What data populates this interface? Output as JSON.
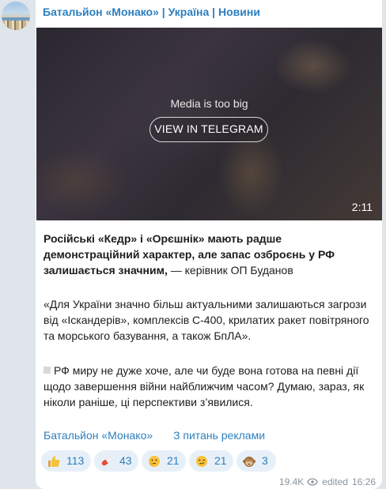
{
  "channel": {
    "title": "Батальйон «Монако» | Україна | Новини"
  },
  "media": {
    "message": "Media is too big",
    "button_label": "VIEW IN TELEGRAM",
    "duration": "2:11"
  },
  "post": {
    "headline": "Російські «Кедр» і «Орєшнік» мають радше демонстраційний характер, але запас озброєнь у РФ залишається значним,",
    "headline_tail": " — керівник ОП Буданов",
    "quote": "«Для України значно більш актуальними залишаються загрози від «Іскандерів», комплексів С-400, крилатих ракет повітряного та морського базування, а також БпЛА».",
    "paragraph3": "РФ миру не дуже хоче, але чи буде вона готова на певні дії щодо завершення війни найближчим часом? Думаю, зараз, як ніколи раніше, ці перспективи з’явилися."
  },
  "links": {
    "channel_link": "Батальйон «Монако»",
    "ad_link": "З питань реклами"
  },
  "reactions": [
    {
      "emoji": "thumbs-up-icon",
      "count": "113"
    },
    {
      "emoji": "pill-icon",
      "count": "43"
    },
    {
      "emoji": "thinking-face-icon",
      "count": "21"
    },
    {
      "emoji": "smirking-face-icon",
      "count": "21"
    },
    {
      "emoji": "see-no-evil-monkey-icon",
      "count": "3"
    }
  ],
  "footer": {
    "views": "19.4K",
    "edited_label": "edited",
    "time": "16:26"
  },
  "colors": {
    "background": "#dfe5ea",
    "link": "#2c7fbf",
    "reaction_bg": "#e7f0f8"
  }
}
